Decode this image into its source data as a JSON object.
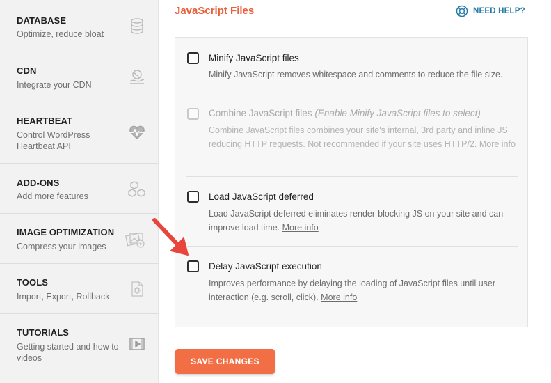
{
  "sidebar": {
    "items": [
      {
        "title": "DATABASE",
        "desc": "Optimize, reduce bloat",
        "icon": "database-icon"
      },
      {
        "title": "CDN",
        "desc": "Integrate your CDN",
        "icon": "cdn-globe-icon"
      },
      {
        "title": "HEARTBEAT",
        "desc": "Control WordPress Heartbeat API",
        "icon": "heartbeat-icon"
      },
      {
        "title": "ADD-ONS",
        "desc": "Add more features",
        "icon": "addons-cubes-icon"
      },
      {
        "title": "IMAGE OPTIMIZATION",
        "desc": "Compress your images",
        "icon": "image-optimization-icon"
      },
      {
        "title": "TOOLS",
        "desc": "Import, Export, Rollback",
        "icon": "tools-gear-icon"
      },
      {
        "title": "TUTORIALS",
        "desc": "Getting started and how to videos",
        "icon": "tutorials-video-icon"
      }
    ]
  },
  "main": {
    "section_title": "JavaScript Files",
    "help_label": "NEED HELP?",
    "options": [
      {
        "label": "Minify JavaScript files",
        "note": "",
        "desc": "Minify JavaScript removes whitespace and comments to reduce the file size.",
        "link": "",
        "checked": false,
        "disabled": false
      },
      {
        "label": "Combine JavaScript files",
        "note": "(Enable Minify JavaScript files to select)",
        "desc": "Combine JavaScript files combines your site's internal, 3rd party and inline JS reducing HTTP requests. Not recommended if your site uses HTTP/2.",
        "link": "More info",
        "checked": false,
        "disabled": true
      },
      {
        "label": "Load JavaScript deferred",
        "note": "",
        "desc": "Load JavaScript deferred eliminates render-blocking JS on your site and can improve load time.",
        "link": "More info",
        "checked": false,
        "disabled": false
      },
      {
        "label": "Delay JavaScript execution",
        "note": "",
        "desc": "Improves performance by delaying the loading of JavaScript files until user interaction (e.g. scroll, click).",
        "link": "More info",
        "checked": false,
        "disabled": false
      }
    ],
    "save_label": "SAVE CHANGES"
  },
  "colors": {
    "accent": "#f26e45",
    "section_title": "#e8603c",
    "help": "#267ba3",
    "arrow": "#e8453c"
  }
}
